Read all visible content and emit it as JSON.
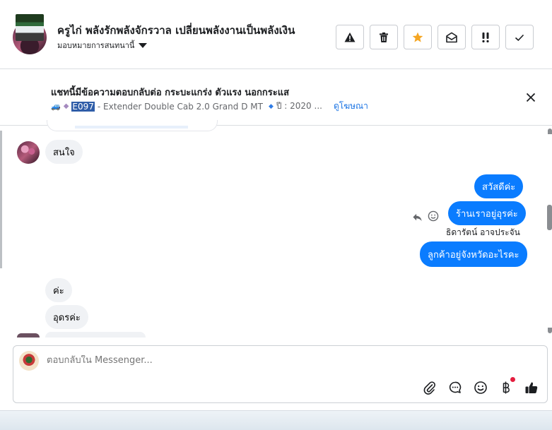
{
  "header": {
    "name": "ครูไก่ พลังรักพลังจักรวาล เปลี่ยนพลังงานเป็นพลังเงิน",
    "assign_label": "มอบหมายการสนทนานี้",
    "actions": [
      "report",
      "delete",
      "star",
      "mark-unread",
      "priority",
      "done"
    ]
  },
  "ad": {
    "title": "แชทนี้มีข้อความตอบกลับต่อ กระบะแกร่ง ตัวแรง นอกกระแส",
    "code": "E097",
    "detail": "- Extender Double Cab 2.0 Grand D MT",
    "year": "ปี : 2020 ...",
    "link": "ดูโฆษณา"
  },
  "messages": {
    "incoming_1": "สนใจ",
    "outgoing_1": "สวัสดีค่ะ",
    "outgoing_2": "ร้านเราอยู่อุรค่ะ",
    "sender_name": "ธิดารัตน์ อาจประจัน",
    "outgoing_3": "ลูกค้าอยู่จังหวัดอะไรคะ",
    "incoming_2": "ค่ะ",
    "incoming_3": "อุดรค่ะ"
  },
  "composer": {
    "placeholder": "ตอบกลับใน Messenger..."
  },
  "colors": {
    "accent": "#0a7cff",
    "star": "#f5a623",
    "link": "#1b74e4"
  }
}
